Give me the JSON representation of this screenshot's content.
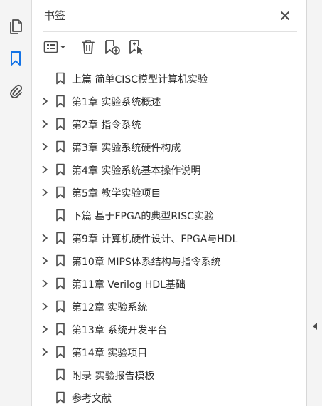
{
  "panel": {
    "title": "书签",
    "close_icon": "close-icon"
  },
  "left_rail": {
    "items": [
      {
        "name": "page-thumbnails",
        "icon": "pages-icon",
        "active": false
      },
      {
        "name": "bookmarks",
        "icon": "bookmark-icon",
        "active": true
      },
      {
        "name": "attachments",
        "icon": "paperclip-icon",
        "active": false
      }
    ]
  },
  "toolbar": {
    "buttons": [
      {
        "name": "options-menu",
        "icon": "list-options-icon"
      },
      {
        "name": "delete-bookmark",
        "icon": "trash-icon"
      },
      {
        "name": "new-bookmark",
        "icon": "bookmark-add-icon"
      },
      {
        "name": "new-bookmark-from-selection",
        "icon": "bookmark-cursor-icon"
      }
    ]
  },
  "bookmarks": [
    {
      "label": "上篇 简单CISC模型计算机实验",
      "expandable": false
    },
    {
      "label": "第1章 实验系统概述",
      "expandable": true
    },
    {
      "label": "第2章 指令系统",
      "expandable": true
    },
    {
      "label": "第3章 实验系统硬件构成",
      "expandable": true
    },
    {
      "label": "第4章 实验系统基本操作说明",
      "expandable": true,
      "hovered": true
    },
    {
      "label": "第5章 教学实验项目",
      "expandable": true
    },
    {
      "label": "下篇 基于FPGA的典型RISC实验",
      "expandable": false
    },
    {
      "label": "第9章 计算机硬件设计、FPGA与HDL",
      "expandable": true
    },
    {
      "label": "第10章 MIPS体系结构与指令系统",
      "expandable": true
    },
    {
      "label": "第11章 Verilog HDL基础",
      "expandable": true
    },
    {
      "label": "第12章 实验系统",
      "expandable": true
    },
    {
      "label": "第13章 系统开发平台",
      "expandable": true
    },
    {
      "label": "第14章 实验项目",
      "expandable": true
    },
    {
      "label": "附录 实验报告模板",
      "expandable": false
    },
    {
      "label": "参考文献",
      "expandable": false
    }
  ],
  "colors": {
    "accent": "#1473e6",
    "icon": "#4b4b4b",
    "rail_bg": "#f4f4f4"
  }
}
